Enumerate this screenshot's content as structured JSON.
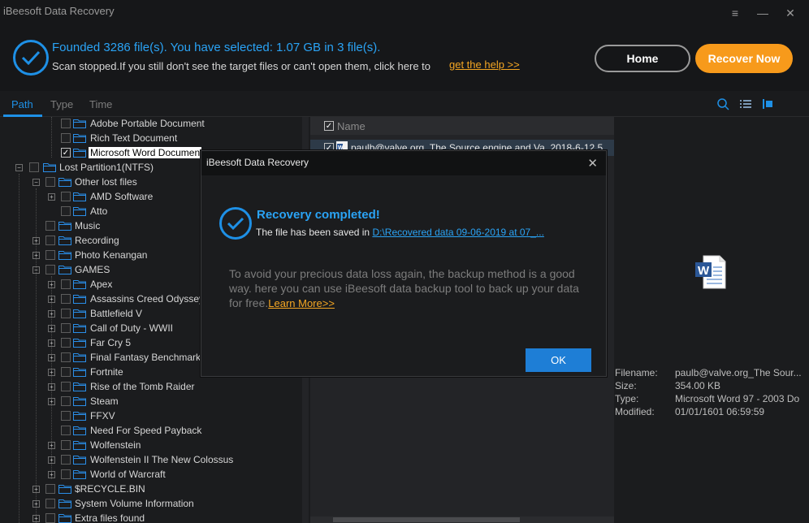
{
  "window": {
    "title": "iBeesoft Data Recovery",
    "controls": [
      "≡",
      "—",
      "✕"
    ]
  },
  "header": {
    "found_text": "Founded 3286 file(s). You have selected: 1.07 GB in 3 file(s).",
    "scan_text": "Scan stopped.If you still don't see the target files or can't open them, click here to",
    "help_link": "get the help >>",
    "home_button": "Home",
    "recover_button": "Recover Now"
  },
  "tabs": [
    "Path",
    "Type",
    "Time"
  ],
  "toolbar_icons": [
    "search-icon",
    "list-view-icon",
    "thumbnail-view-icon"
  ],
  "tree": [
    {
      "label": "Adobe Portable Document",
      "level": 2,
      "checked": false,
      "expandable": false,
      "selected": false
    },
    {
      "label": "Rich Text Document",
      "level": 2,
      "checked": false,
      "expandable": false,
      "selected": false
    },
    {
      "label": "Microsoft Word Documen",
      "level": 2,
      "checked": true,
      "expandable": false,
      "selected": true
    },
    {
      "label": "Lost Partition1(NTFS)",
      "level": 0,
      "checked": false,
      "expandable": true,
      "selected": false
    },
    {
      "label": "Other lost files",
      "level": 1,
      "checked": false,
      "expandable": true,
      "selected": false
    },
    {
      "label": "AMD Software",
      "level": 2,
      "checked": false,
      "expandable": true,
      "selected": false
    },
    {
      "label": "Atto",
      "level": 2,
      "checked": false,
      "expandable": false,
      "selected": false
    },
    {
      "label": "Music",
      "level": 1,
      "checked": false,
      "expandable": false,
      "selected": false
    },
    {
      "label": "Recording",
      "level": 1,
      "checked": false,
      "expandable": true,
      "selected": false
    },
    {
      "label": "Photo Kenangan",
      "level": 1,
      "checked": false,
      "expandable": true,
      "selected": false
    },
    {
      "label": "GAMES",
      "level": 1,
      "checked": false,
      "expandable": true,
      "selected": false
    },
    {
      "label": "Apex",
      "level": 2,
      "checked": false,
      "expandable": true,
      "selected": false
    },
    {
      "label": "Assassins Creed Odyssey",
      "level": 2,
      "checked": false,
      "expandable": true,
      "selected": false
    },
    {
      "label": "Battlefield V",
      "level": 2,
      "checked": false,
      "expandable": true,
      "selected": false
    },
    {
      "label": "Call of Duty - WWII",
      "level": 2,
      "checked": false,
      "expandable": true,
      "selected": false
    },
    {
      "label": "Far Cry 5",
      "level": 2,
      "checked": false,
      "expandable": true,
      "selected": false
    },
    {
      "label": "Final Fantasy Benchmark",
      "level": 2,
      "checked": false,
      "expandable": true,
      "selected": false
    },
    {
      "label": "Fortnite",
      "level": 2,
      "checked": false,
      "expandable": true,
      "selected": false
    },
    {
      "label": "Rise of the Tomb Raider",
      "level": 2,
      "checked": false,
      "expandable": true,
      "selected": false
    },
    {
      "label": "Steam",
      "level": 2,
      "checked": false,
      "expandable": true,
      "selected": false
    },
    {
      "label": "FFXV",
      "level": 2,
      "checked": false,
      "expandable": false,
      "selected": false
    },
    {
      "label": "Need For Speed Payback",
      "level": 2,
      "checked": false,
      "expandable": false,
      "selected": false
    },
    {
      "label": "Wolfenstein",
      "level": 2,
      "checked": false,
      "expandable": true,
      "selected": false
    },
    {
      "label": "Wolfenstein II The New Colossus",
      "level": 2,
      "checked": false,
      "expandable": true,
      "selected": false
    },
    {
      "label": "World of Warcraft",
      "level": 2,
      "checked": false,
      "expandable": true,
      "selected": false
    },
    {
      "label": "$RECYCLE.BIN",
      "level": 1,
      "checked": false,
      "expandable": true,
      "selected": false
    },
    {
      "label": "System Volume Information",
      "level": 1,
      "checked": false,
      "expandable": true,
      "selected": false
    },
    {
      "label": "Extra files found",
      "level": 1,
      "checked": false,
      "expandable": true,
      "selected": false
    }
  ],
  "file_list": {
    "header": "Name",
    "rows": [
      {
        "name": "paulb@valve.org_The Source engine and Va_2018-6-12.5",
        "checked": true
      }
    ]
  },
  "preview": {
    "icon": "word-document-icon",
    "labels": {
      "filename": "Filename:",
      "size": "Size:",
      "type": "Type:",
      "modified": "Modified:"
    },
    "values": {
      "filename": "paulb@valve.org_The Sour...",
      "size": "354.00 KB",
      "type": "Microsoft Word 97 - 2003 Do",
      "modified": "01/01/1601 06:59:59"
    }
  },
  "dialog": {
    "title": "iBeesoft Data Recovery",
    "heading": "Recovery completed!",
    "saved_prefix": "The file has been saved in",
    "saved_path": "D:\\Recovered data 09-06-2019 at 07_...",
    "body": "To avoid your precious data loss again, the backup method is a good way.  here you can use iBeesoft data backup tool to back up your data for free.",
    "learn_more": "Learn More>>",
    "ok": "OK"
  },
  "colors": {
    "accent": "#1e90e6",
    "orange": "#f79a1b",
    "background": "#1b1c1e"
  }
}
